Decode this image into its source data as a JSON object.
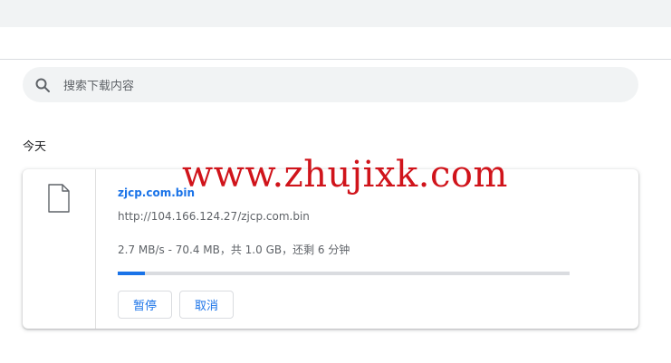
{
  "search": {
    "placeholder": "搜索下载内容"
  },
  "section": {
    "title": "今天"
  },
  "download": {
    "filename": "zjcp.com.bin",
    "url": "http://104.166.124.27/zjcp.com.bin",
    "status": "2.7 MB/s - 70.4 MB，共 1.0 GB，还剩 6 分钟",
    "progress_fraction": 0.06,
    "pause_label": "暂停",
    "cancel_label": "取消"
  },
  "watermark": "www.zhujixk.com",
  "colors": {
    "accent": "#1a73e8",
    "watermark": "#d0141b",
    "topbar": "#f1f3f4"
  }
}
